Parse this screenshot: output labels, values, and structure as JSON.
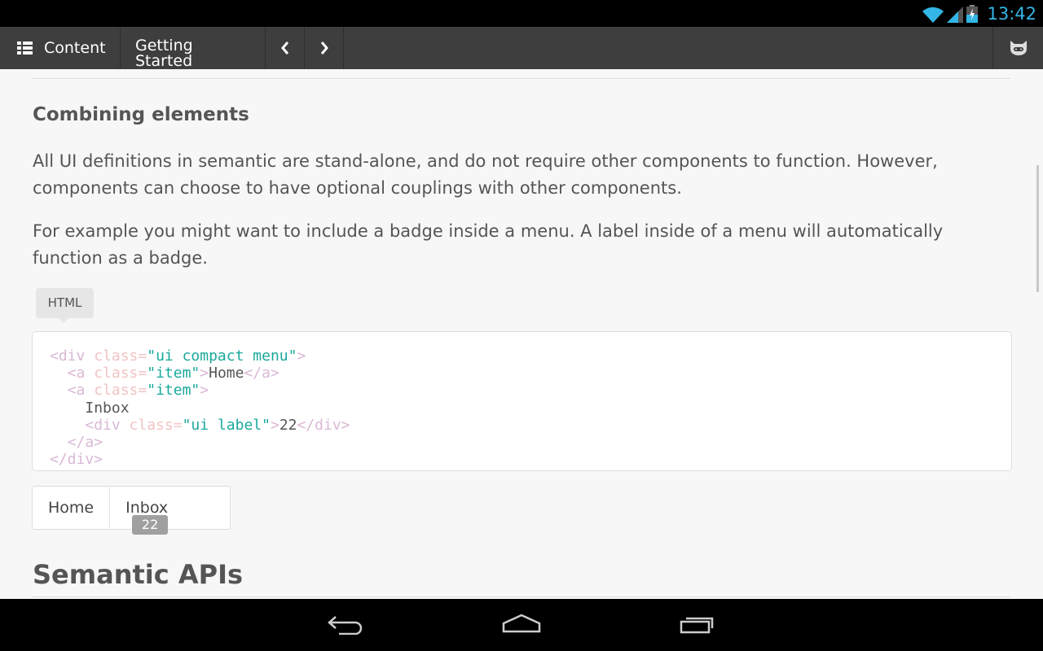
{
  "status_bar": {
    "time": "13:42",
    "icons": [
      "wifi-icon",
      "signal-icon",
      "battery-charging-icon"
    ],
    "accent": "#33b5e5"
  },
  "toolbar": {
    "menu_label": "Content",
    "title": "Getting Started",
    "prev_icon": "chevron-left-icon",
    "next_icon": "chevron-right-icon",
    "github_icon": "octocat-icon"
  },
  "article": {
    "heading": "Combining elements",
    "para1": "All UI definitions in semantic are stand-alone, and do not require other components to function. However, components can choose to have optional couplings with other components.",
    "para2": "For example you might want to include a badge inside a menu. A label inside of a menu will automatically function as a badge.",
    "code_tag": "HTML",
    "code": {
      "l1": {
        "tag": "<div",
        "attr": " class",
        "eq": "=",
        "val": "\"ui compact menu\"",
        "close": ">"
      },
      "l2": {
        "tag": "<a",
        "attr": " class",
        "eq": "=",
        "val": "\"item\"",
        "close": ">",
        "text": "Home",
        "end": "</a>"
      },
      "l3": {
        "tag": "<a",
        "attr": " class",
        "eq": "=",
        "val": "\"item\"",
        "close": ">"
      },
      "l4": {
        "text": "Inbox"
      },
      "l5": {
        "tag": "<div",
        "attr": " class",
        "eq": "=",
        "val": "\"ui label\"",
        "close": ">",
        "text": "22",
        "end": "</div>"
      },
      "l6": {
        "end": "</a>"
      },
      "l7": {
        "end": "</div>"
      }
    },
    "demo_menu": {
      "items": [
        {
          "label": "Home"
        },
        {
          "label": "Inbox",
          "badge": "22"
        }
      ]
    },
    "next_heading": "Semantic APIs"
  },
  "colors": {
    "tag": "#dab8d6",
    "attr": "#f2c4c4",
    "string": "#1aa99b"
  }
}
